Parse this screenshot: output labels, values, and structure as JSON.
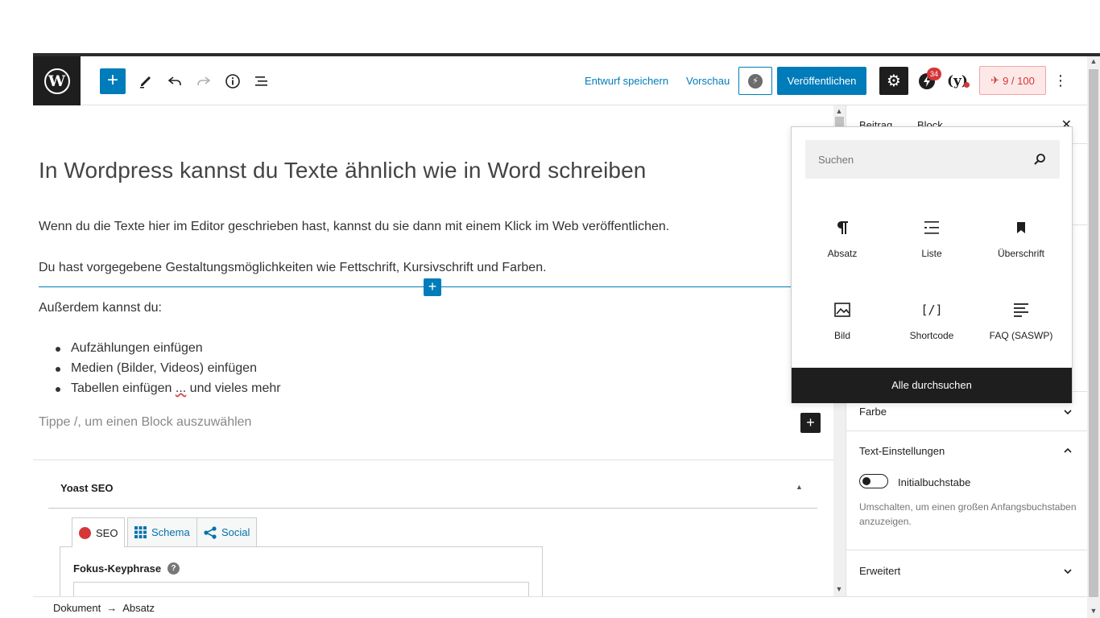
{
  "header": {
    "save_draft": "Entwurf speichern",
    "preview": "Vorschau",
    "publish": "Veröffentlichen",
    "notification_count": "34",
    "seo_score": "9 / 100"
  },
  "post": {
    "title": "In Wordpress kannst du Texte ähnlich wie in Word schreiben",
    "paragraphs": [
      "Wenn du die Texte hier im Editor geschrieben hast, kannst du sie dann mit einem Klick im Web veröffentlichen.",
      "Du hast vorgegebene Gestaltungsmöglichkeiten wie Fettschrift, Kursivschrift und Farben.",
      "Außerdem kannst du:"
    ],
    "list": [
      "Aufzählungen einfügen",
      "Medien (Bilder, Videos) einfügen",
      "Tabellen einfügen ",
      "..."
    ],
    "list_tail": " und vieles mehr",
    "placeholder": "Tippe /, um einen Block auszuwählen"
  },
  "yoast": {
    "title": "Yoast SEO",
    "tabs": [
      "SEO",
      "Schema",
      "Social"
    ],
    "focus_keyphrase": "Fokus-Keyphrase"
  },
  "sidebar": {
    "tabs": [
      "Beitrag",
      "Block"
    ],
    "sections": {
      "color": "Farbe",
      "text_settings": "Text-Einstellungen",
      "drop_cap": "Initialbuchstabe",
      "drop_cap_help": "Umschalten, um einen großen Anfangsbuchstaben anzuzeigen.",
      "advanced": "Erweitert"
    }
  },
  "inserter": {
    "search_placeholder": "Suchen",
    "blocks": [
      "Absatz",
      "Liste",
      "Überschrift",
      "Bild",
      "Shortcode",
      "FAQ (SASWP)"
    ],
    "browse_all": "Alle durchsuchen"
  },
  "breadcrumb": {
    "items": [
      "Dokument",
      "Absatz"
    ],
    "separator": "→"
  },
  "colors": {
    "accent": "#007cba",
    "dark": "#1e1e1e",
    "error": "#d63638"
  }
}
